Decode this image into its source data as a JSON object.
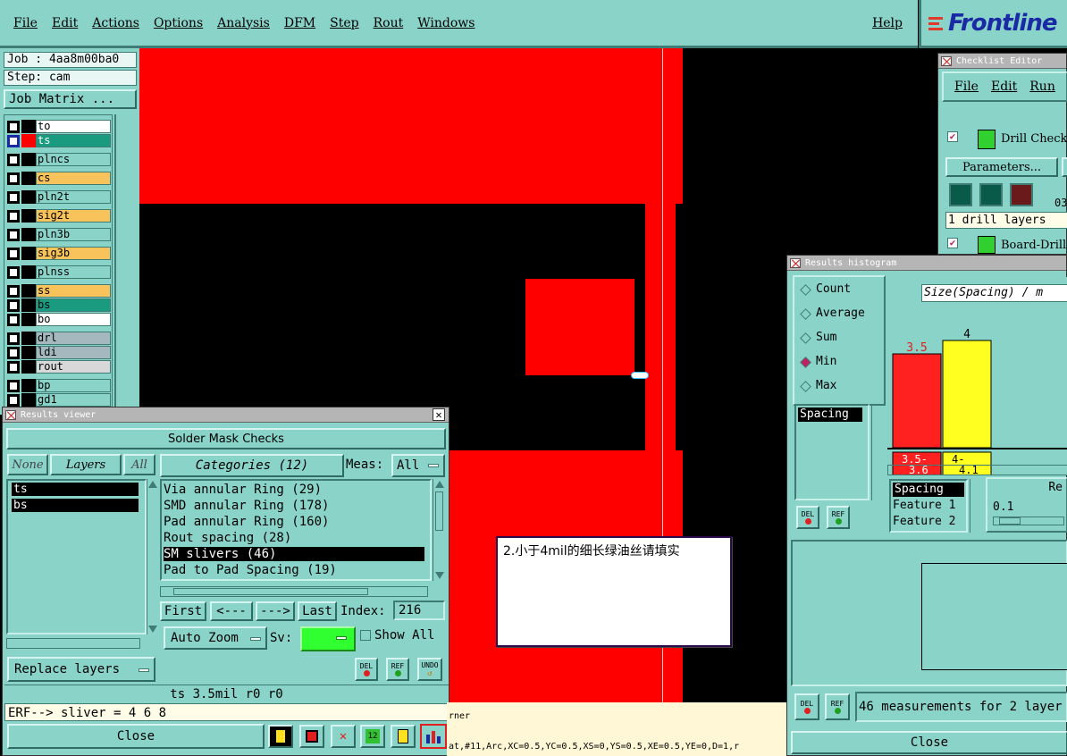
{
  "menubar": {
    "items": [
      "File",
      "Edit",
      "Actions",
      "Options",
      "Analysis",
      "DFM",
      "Step",
      "Rout",
      "Windows"
    ],
    "help": "Help",
    "logo": "Frontline"
  },
  "job": {
    "job_label": "Job : 4aa8m00ba0",
    "step_label": "Step: cam",
    "matrix_button": "Job Matrix ..."
  },
  "layers": [
    {
      "name": "to",
      "color": "#ffffff"
    },
    {
      "name": "ts",
      "color": "#1a9a7e",
      "selected": true
    },
    {
      "name": "plncs",
      "color": "#8ad3c9"
    },
    {
      "name": "cs",
      "color": "#f7c35a"
    },
    {
      "name": "pln2t",
      "color": "#8ad3c9"
    },
    {
      "name": "sig2t",
      "color": "#f7c35a"
    },
    {
      "name": "pln3b",
      "color": "#8ad3c9"
    },
    {
      "name": "sig3b",
      "color": "#f7c35a"
    },
    {
      "name": "plnss",
      "color": "#8ad3c9"
    },
    {
      "name": "ss",
      "color": "#f7c35a"
    },
    {
      "name": "bs",
      "color": "#1a9a7e"
    },
    {
      "name": "bo",
      "color": "#ffffff"
    },
    {
      "name": "drl",
      "color": "#a5b8bd"
    },
    {
      "name": "ldi",
      "color": "#a5b8bd"
    },
    {
      "name": "rout",
      "color": "#d8d8d8"
    },
    {
      "name": "bp",
      "color": "#8ad3c9"
    },
    {
      "name": "gd1",
      "color": "#8ad3c9"
    }
  ],
  "results_viewer": {
    "title": "Results viewer",
    "header": "Solder Mask Checks",
    "none_btn": "None",
    "layers_btn": "Layers",
    "all_btn": "All",
    "categories_btn": "Categories (12)",
    "meas_label": "Meas:",
    "meas_value": "All",
    "layer_list": [
      "ts",
      "bs"
    ],
    "categories": [
      {
        "label": "Via annular Ring (29)",
        "selected": false
      },
      {
        "label": "SMD annular Ring (178)",
        "selected": false
      },
      {
        "label": "Pad annular Ring (160)",
        "selected": false
      },
      {
        "label": "Rout spacing (28)",
        "selected": false
      },
      {
        "label": "SM slivers (46)",
        "selected": true
      },
      {
        "label": "Pad to Pad Spacing (19)",
        "selected": false
      }
    ],
    "first_btn": "First",
    "prev_btn": "<---",
    "next_btn": "--->",
    "last_btn": "Last",
    "index_label": "Index:",
    "index_value": "216",
    "auto_zoom": "Auto Zoom",
    "sv_label": "Sv:",
    "show_all": "Show All",
    "replace_layers": "Replace layers",
    "del_btn": "DEL",
    "ref_btn": "REF",
    "undo_btn": "UNDO",
    "info_line": "ts 3.5mil  r0  r0",
    "erf_line": "ERF--> sliver = 4 6 8",
    "close_btn": "Close"
  },
  "note": {
    "text": "2.小于4mil的细长绿油丝请填实"
  },
  "checklist_editor": {
    "title": "Checklist Editor",
    "menu": [
      "File",
      "Edit",
      "Run"
    ],
    "item1": "Drill Check",
    "params_btn": "Parameters...",
    "drill_text": "1 drill layers",
    "item2": "Board-Drill",
    "side_num": "03"
  },
  "histogram": {
    "title": "Results histogram",
    "options": [
      {
        "label": "Count",
        "selected": false
      },
      {
        "label": "Average",
        "selected": false
      },
      {
        "label": "Sum",
        "selected": false
      },
      {
        "label": "Min",
        "selected": true
      },
      {
        "label": "Max",
        "selected": false
      }
    ],
    "chart_title": "Size(Spacing) / m",
    "list1": [
      "Spacing"
    ],
    "list2": [
      "Spacing",
      "Feature 1",
      "Feature 2"
    ],
    "re_label": "Re",
    "slider_value": "0.1",
    "footer": "46 measurements for 2 layer",
    "close_btn": "Close",
    "del_btn": "DEL",
    "ref_btn": "REF"
  },
  "chart_data": {
    "type": "bar",
    "categories": [
      "3.5-3.6",
      "4-4.1"
    ],
    "category_lines": [
      [
        "3.5-",
        "3.6"
      ],
      [
        "4-",
        "4.1"
      ]
    ],
    "value_labels": [
      "3.5",
      "4"
    ],
    "values": [
      3.5,
      4
    ],
    "colors": [
      "#ff2020",
      "#ffff20"
    ],
    "title": "Size(Spacing) / m"
  },
  "status": {
    "line1": "rner",
    "line2": "at,#11,Arc,XC=0.5,YC=0.5,XS=0,YS=0.5,XE=0.5,YE=0,D=1,r"
  }
}
